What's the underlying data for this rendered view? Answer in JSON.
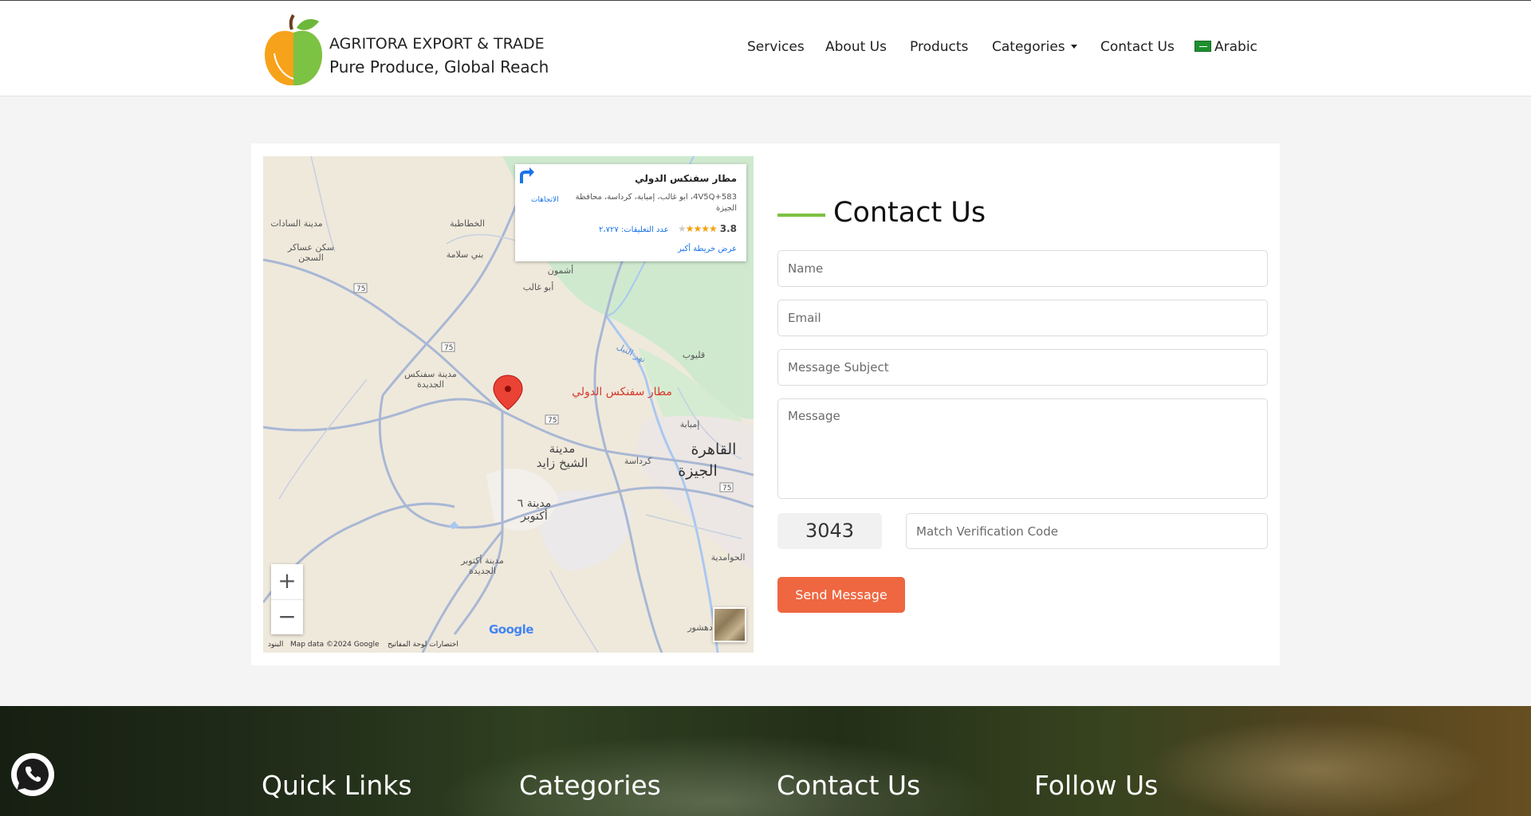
{
  "header": {
    "brand_name": "AGRITORA EXPORT & TRADE",
    "tagline": "Pure Produce, Global Reach",
    "nav": [
      {
        "label": "Services"
      },
      {
        "label": "About Us"
      },
      {
        "label": "Products"
      },
      {
        "label": "Categories"
      },
      {
        "label": "Contact Us"
      },
      {
        "label": "Arabic"
      }
    ]
  },
  "map": {
    "place_title": "مطار سفنكس الدولي",
    "address": "4V5Q+583، ابو غالب، إمبابة، كرداسة، محافظة الجيزة",
    "rating": "3.8",
    "reviews": "عدد التعليقات: ٢،٧٢٧",
    "view_larger": "عرض خريطة أكبر",
    "directions": "الاتجاهات",
    "marker_label": "مطار سفنكس الدولي",
    "zoom_in": "+",
    "zoom_out": "−",
    "google": "Google",
    "map_data": "Map data ©2024 Google",
    "shortcuts": "اختصارات لوحة المفاتيح",
    "terms": "البنود",
    "labels": {
      "sadat": "مدينة السادات",
      "khatatba": "الخطاطبة",
      "soldiers": "سكن عساكر",
      "soldiers2": "السجن",
      "salama": "بني سلامة",
      "ashmoun": "أشمون",
      "abughalib": "أبو غالب",
      "nile": "نهر النيل",
      "qalyub": "قليوب",
      "sphinx_new": "مدينة سفنكس",
      "sphinx_new2": "الجديدة",
      "imbaba": "إمبابة",
      "cairo": "القاهرة",
      "giza": "الجيزة",
      "zayed": "مدينة",
      "zayed2": "الشيخ زايد",
      "kerdasa": "كرداسة",
      "october": "مدينة ٦",
      "october2": "أكتوبر",
      "new_october": "مدينة أكتوبر",
      "new_october2": "الجديدة",
      "hawamdia": "الحوامدية",
      "dahshur": "دهشور",
      "road75": "75"
    }
  },
  "contact": {
    "heading": "Contact Us",
    "name_placeholder": "Name",
    "email_placeholder": "Email",
    "subject_placeholder": "Message Subject",
    "message_placeholder": "Message",
    "captcha_code": "3043",
    "verify_placeholder": "Match Verification Code",
    "send_label": "Send Message"
  },
  "footer": {
    "columns": [
      "Quick Links",
      "Categories",
      "Contact Us",
      "Follow Us"
    ]
  },
  "colors": {
    "accent_green": "#7bc142",
    "button_orange": "#ee6740",
    "whatsapp_green": "#25d366"
  },
  "icons": {
    "whatsapp": "whatsapp-icon",
    "caret": "chevron-down-icon",
    "flag": "saudi-flag-icon",
    "marker": "map-pin-icon",
    "directions": "directions-icon"
  }
}
